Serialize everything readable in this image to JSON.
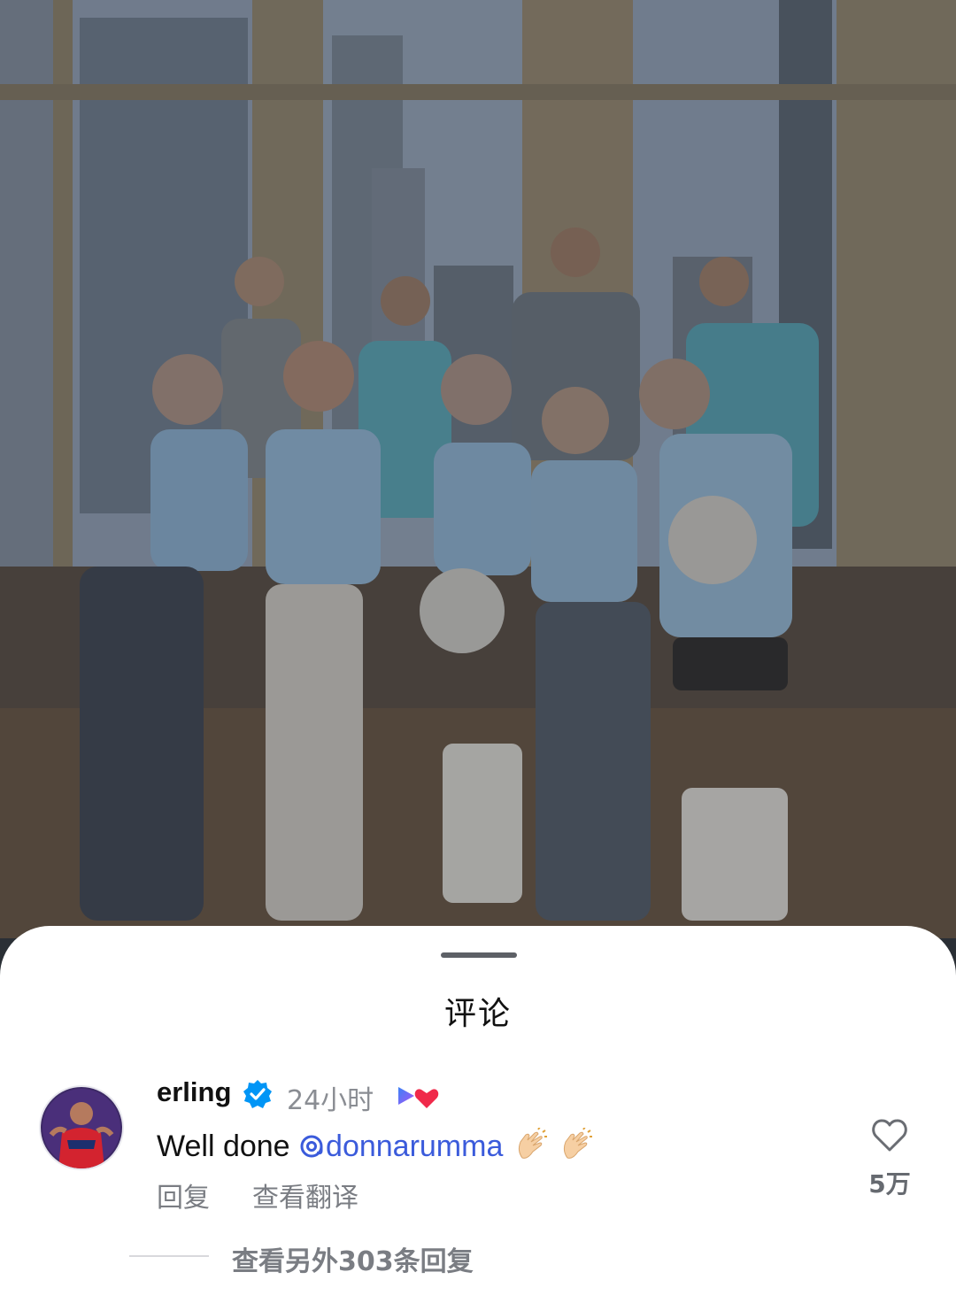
{
  "sheet": {
    "title": "评论"
  },
  "comment": {
    "username": "erling",
    "time": "24小时",
    "text_prefix": "Well done ",
    "mention": "donnarumma",
    "like_count": "5万",
    "reply_label": "回复",
    "translate_label": "查看翻译",
    "view_replies_label": "查看另外303条回复"
  },
  "icons": {
    "verified": "verified-badge-icon",
    "creator": "creator-heart-icon",
    "mention_at": "threads-at-icon",
    "clap": "clapping-hands-icon",
    "like": "heart-outline-icon"
  },
  "colors": {
    "mention": "#3b5bdb",
    "verified": "#0095f6",
    "heart": "#f0294a",
    "muted_text": "#7a7d83"
  }
}
